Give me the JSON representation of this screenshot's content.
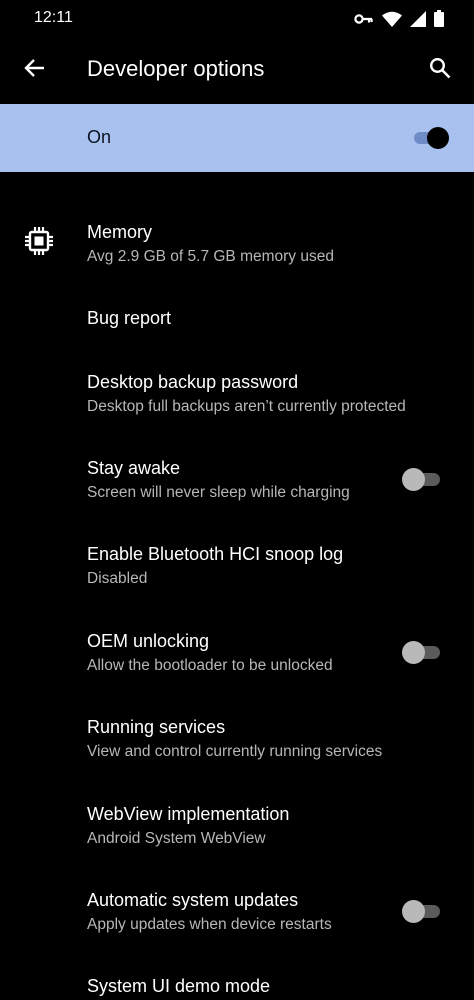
{
  "status_bar": {
    "time": "12:11",
    "icons": [
      "vpn-key-icon",
      "wifi-icon",
      "signal-icon",
      "battery-icon"
    ]
  },
  "app_bar": {
    "title": "Developer options",
    "back_icon": "arrow-back-icon",
    "search_icon": "search-icon"
  },
  "master_switch": {
    "label": "On",
    "checked": true
  },
  "items": [
    {
      "title": "Memory",
      "summary": "Avg 2.9 GB of 5.7 GB memory used",
      "icon": "memory-chip-icon"
    },
    {
      "title": "Bug report",
      "summary": ""
    },
    {
      "title": "Desktop backup password",
      "summary": "Desktop full backups aren’t currently protected"
    },
    {
      "title": "Stay awake",
      "summary": "Screen will never sleep while charging",
      "toggle": false
    },
    {
      "title": "Enable Bluetooth HCI snoop log",
      "summary": "Disabled"
    },
    {
      "title": "OEM unlocking",
      "summary": "Allow the bootloader to be unlocked",
      "toggle": false
    },
    {
      "title": "Running services",
      "summary": "View and control currently running services"
    },
    {
      "title": "WebView implementation",
      "summary": "Android System WebView"
    },
    {
      "title": "Automatic system updates",
      "summary": "Apply updates when device restarts",
      "toggle": false
    },
    {
      "title": "System UI demo mode",
      "summary": ""
    }
  ],
  "colors": {
    "background": "#000000",
    "master_bar": "#a8c1ef",
    "summary_text": "#b7b7b7",
    "switch_track_off": "#5b5b5b",
    "switch_thumb_off": "#b9b9b9"
  }
}
